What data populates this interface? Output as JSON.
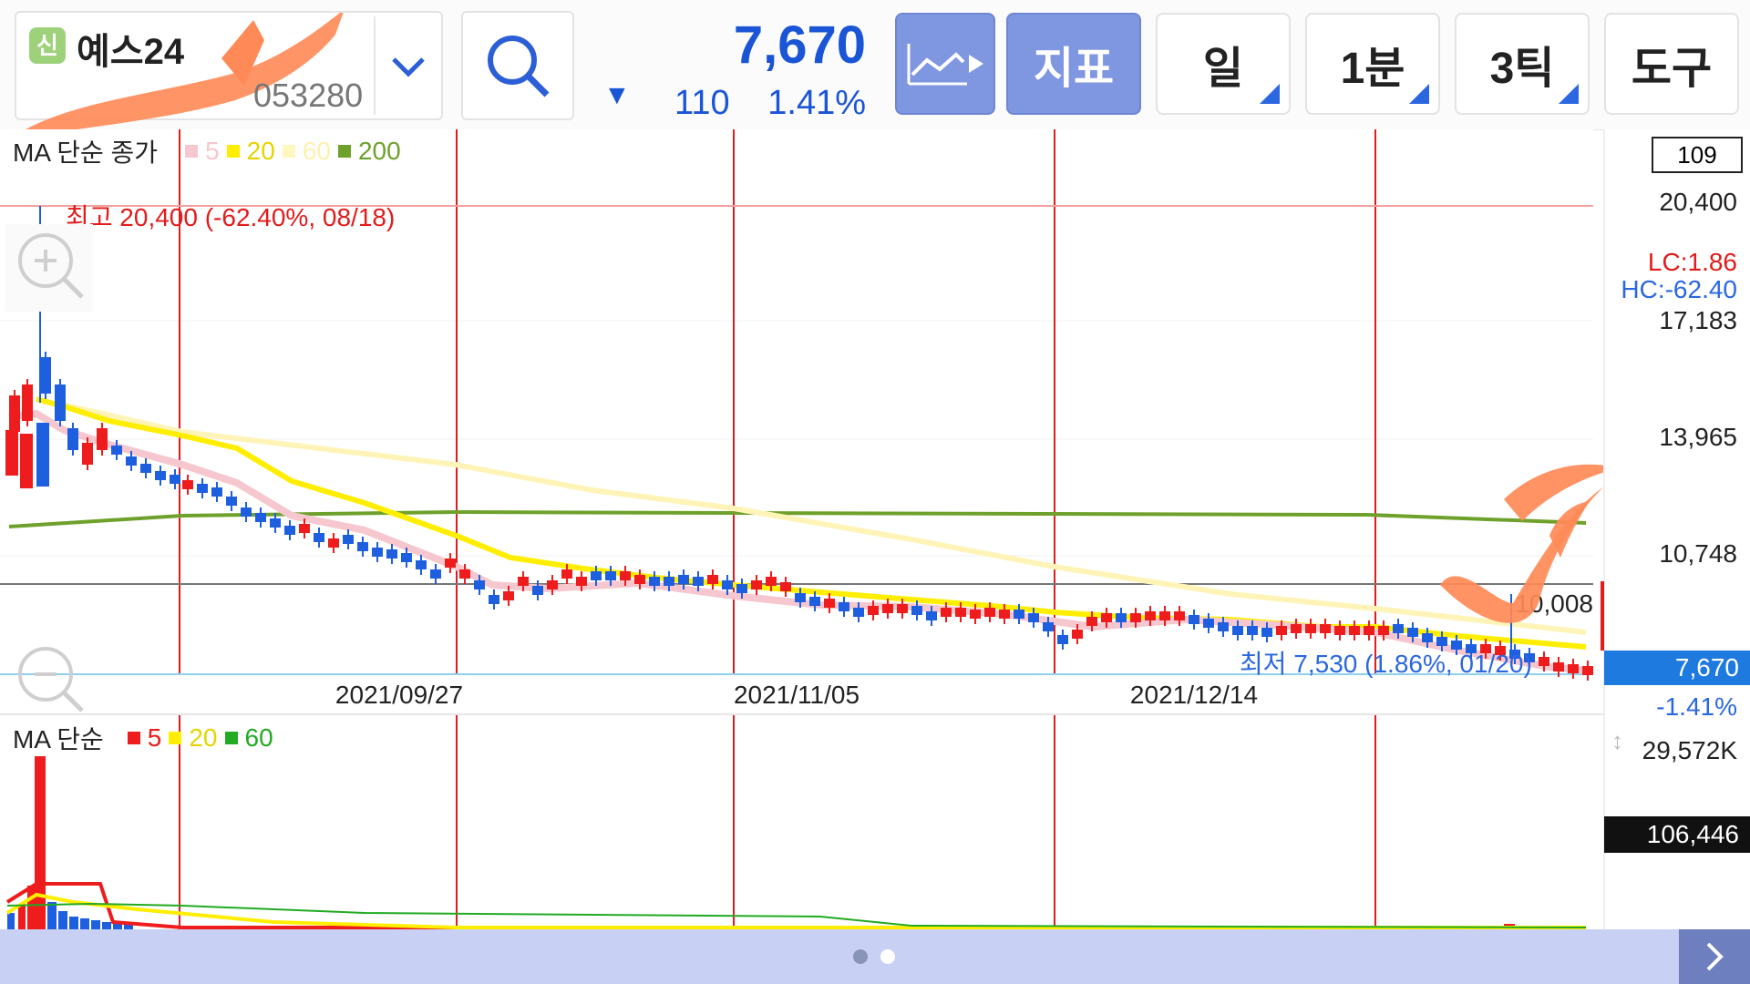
{
  "stock": {
    "badge": "신",
    "name": "예스24",
    "code": "053280"
  },
  "quote": {
    "price": "7,670",
    "change": "110",
    "pct": "1.41%",
    "direction": "down"
  },
  "toolbar": {
    "chart_icon": "chart-line-icon",
    "indicator": "지표",
    "period": "일",
    "interval": "1분",
    "tick": "3틱",
    "tools": "도구"
  },
  "main_legend": {
    "title": "MA 단순 종가",
    "ma": [
      {
        "label": "5",
        "color": "#f6c7cf"
      },
      {
        "label": "20",
        "color": "#ffee00"
      },
      {
        "label": "60",
        "color": "#fff7c0"
      },
      {
        "label": "200",
        "color": "#6ea12b"
      }
    ]
  },
  "vol_legend": {
    "title": "MA 단순",
    "ma": [
      {
        "label": "5",
        "color": "#ee1c1c"
      },
      {
        "label": "20",
        "color": "#ffee00"
      },
      {
        "label": "60",
        "color": "#22aa22"
      }
    ]
  },
  "chart_labels": {
    "high_note": "최고 20,400 (-62.40%, 08/18)",
    "low_note": "최저 7,530 (1.86%, 01/20)",
    "mid_value": "10,008",
    "count_box": "109",
    "lc": "LC:1.86",
    "hc": "HC:-62.40",
    "price_box": "7,670",
    "price_pct": "-1.41%",
    "vol_label": "29,572K",
    "vol_box": "106,446"
  },
  "y_axis_ticks": [
    "20,400",
    "17,183",
    "13,965",
    "10,748"
  ],
  "x_axis_ticks": [
    "2021/09/27",
    "2021/11/05",
    "2021/12/14"
  ],
  "chart_data": {
    "type": "candlestick",
    "title": "",
    "y_range": [
      7530,
      20400
    ],
    "series": [
      {
        "name": "5",
        "values": []
      },
      {
        "name": "20",
        "values": []
      },
      {
        "name": "60",
        "values": []
      },
      {
        "name": "200",
        "values": []
      }
    ],
    "high": 20400,
    "low": 7530,
    "last": 7670
  }
}
